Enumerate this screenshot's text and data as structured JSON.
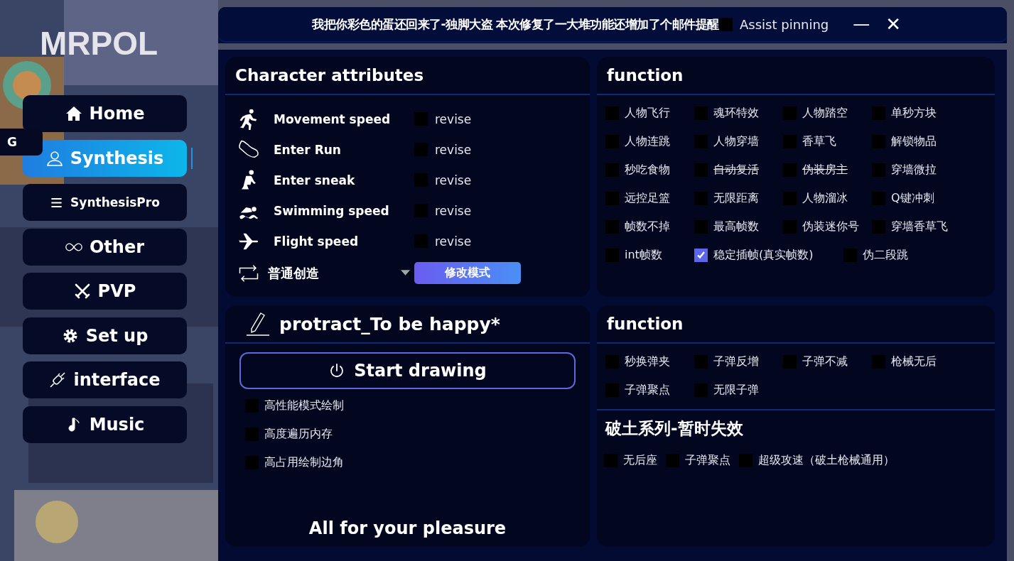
{
  "sidebar": {
    "logo": "MRPOL",
    "side_tab": "G",
    "items": [
      {
        "label": "Home",
        "kind": "home",
        "selected": false
      },
      {
        "label": "Synthesis",
        "kind": "user",
        "selected": true
      },
      {
        "label": "SynthesisPro",
        "kind": "menu",
        "selected": false
      },
      {
        "label": "Other",
        "kind": "infinity",
        "selected": false
      },
      {
        "label": "PVP",
        "kind": "swords",
        "selected": false
      },
      {
        "label": "Set up",
        "kind": "gear",
        "selected": false
      },
      {
        "label": "interface",
        "kind": "plug",
        "selected": false
      },
      {
        "label": "Music",
        "kind": "note",
        "selected": false
      }
    ]
  },
  "window": {
    "title": "我把你彩色的蛋还回来了-独脚大盗 本次修复了一大堆功能还增加了个邮件提醒",
    "assist_pinning": {
      "label": "Assist pinning",
      "checked": false
    },
    "minimize": "—",
    "close": "✕"
  },
  "character_attributes": {
    "title": "Character attributes",
    "rows": [
      {
        "label": "Movement speed",
        "kind": "run",
        "option": "revise",
        "checked": false
      },
      {
        "label": "Enter Run",
        "kind": "shoe",
        "option": "revise",
        "checked": false
      },
      {
        "label": "Enter sneak",
        "kind": "sneak",
        "option": "revise",
        "checked": false
      },
      {
        "label": "Swimming speed",
        "kind": "swim",
        "option": "revise",
        "checked": false
      },
      {
        "label": "Flight speed",
        "kind": "plane",
        "option": "revise",
        "checked": false
      }
    ],
    "mode_select": "普通创造",
    "mode_button": "修改模式"
  },
  "function": {
    "title": "function",
    "rows": [
      [
        {
          "label": "人物飞行",
          "checked": false,
          "struck": false
        },
        {
          "label": "魂环特效",
          "checked": false,
          "struck": false
        },
        {
          "label": "人物踏空",
          "checked": false,
          "struck": false
        },
        {
          "label": "单秒方块",
          "checked": false,
          "struck": false
        }
      ],
      [
        {
          "label": "人物连跳",
          "checked": false,
          "struck": false
        },
        {
          "label": "人物穿墙",
          "checked": false,
          "struck": false
        },
        {
          "label": "香草飞",
          "checked": false,
          "struck": false
        },
        {
          "label": "解锁物品",
          "checked": false,
          "struck": false
        }
      ],
      [
        {
          "label": "秒吃食物",
          "checked": false,
          "struck": false
        },
        {
          "label": "自动复活",
          "checked": false,
          "struck": true
        },
        {
          "label": "伪装房主",
          "checked": false,
          "struck": true
        },
        {
          "label": "穿墙微拉",
          "checked": false,
          "struck": false
        }
      ],
      [
        {
          "label": "远控足篮",
          "checked": false,
          "struck": false
        },
        {
          "label": "无限距离",
          "checked": false,
          "struck": false
        },
        {
          "label": "人物溜冰",
          "checked": false,
          "struck": false
        },
        {
          "label": "Q键冲刺",
          "checked": false,
          "struck": false
        }
      ],
      [
        {
          "label": "帧数不掉",
          "checked": false,
          "struck": false
        },
        {
          "label": "最高帧数",
          "checked": false,
          "struck": false
        },
        {
          "label": "伪装迷你号",
          "checked": false,
          "struck": false
        },
        {
          "label": "穿墙香草飞",
          "checked": false,
          "struck": false
        }
      ],
      [
        {
          "label": "int帧数",
          "checked": false,
          "struck": false
        },
        {
          "label": "稳定插帧(真实帧数)",
          "checked": true,
          "struck": false
        },
        {
          "label": "伪二段跳",
          "checked": false,
          "struck": false
        }
      ]
    ]
  },
  "protract": {
    "title": "protract_To be happy*",
    "start_button": "Start drawing",
    "options": [
      {
        "label": "高性能模式绘制",
        "checked": false
      },
      {
        "label": "高度遍历内存",
        "checked": false
      },
      {
        "label": "高占用绘制边角",
        "checked": false
      }
    ],
    "footer": "All for your pleasure"
  },
  "function_2": {
    "title": "function",
    "rows": [
      [
        {
          "label": "秒换弹夹",
          "checked": false
        },
        {
          "label": "子弹反增",
          "checked": false
        },
        {
          "label": "子弹不减",
          "checked": false
        },
        {
          "label": "枪械无后",
          "checked": false
        }
      ],
      [
        {
          "label": "子弹聚点",
          "checked": false
        },
        {
          "label": "无限子弹",
          "checked": false
        }
      ]
    ],
    "section_title": "破土系列-暂时失效",
    "section_options": [
      {
        "label": "无后座",
        "checked": false
      },
      {
        "label": "子弹聚点",
        "checked": false
      },
      {
        "label": "超级攻速（破土枪械通用）",
        "checked": false
      }
    ]
  }
}
